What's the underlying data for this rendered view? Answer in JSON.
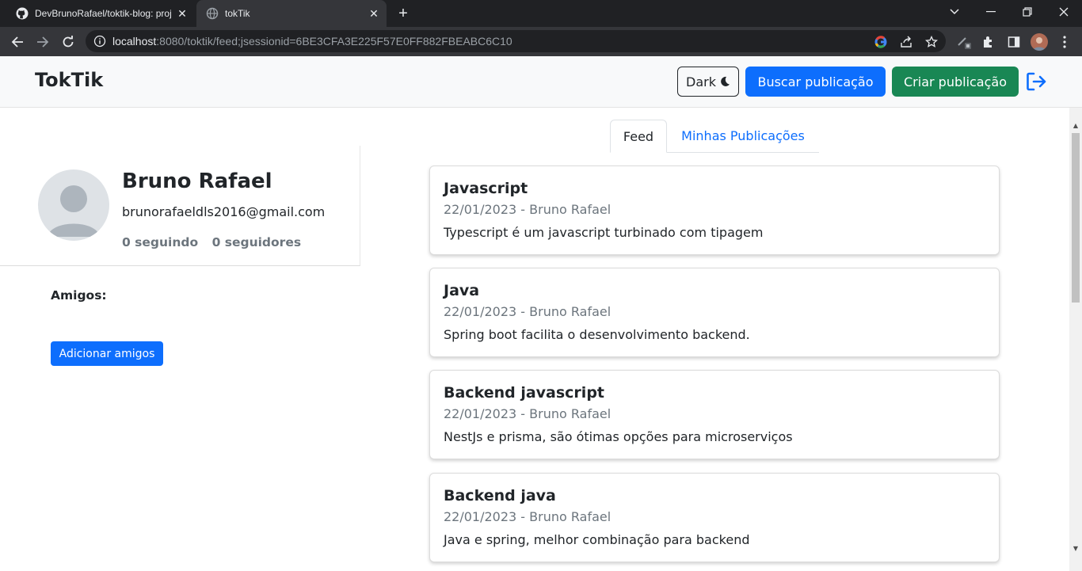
{
  "browser": {
    "tabs": [
      {
        "title": "DevBrunoRafael/toktik-blog: proj",
        "favicon": "github-icon",
        "active": false
      },
      {
        "title": "tokTik",
        "favicon": "globe-icon",
        "active": true
      }
    ],
    "url_host": "localhost",
    "url_rest": ":8080/toktik/feed;jsessionid=6BE3CFA3E225F57E0FF882FBEABC6C10"
  },
  "app": {
    "brand": "TokTik",
    "buttons": {
      "dark": "Dark",
      "search": "Buscar publicação",
      "create": "Criar publicação"
    }
  },
  "profile": {
    "name": "Bruno Rafael",
    "email": "brunorafaeldls2016@gmail.com",
    "following": "0 seguindo",
    "followers": "0 seguidores",
    "friends_label": "Amigos:",
    "add_friends": "Adicionar amigos"
  },
  "tabs": {
    "feed": "Feed",
    "mine": "Minhas Publicações"
  },
  "posts": [
    {
      "title": "Javascript",
      "meta": "22/01/2023 - Bruno Rafael",
      "body": "Typescript é um javascript turbinado com tipagem"
    },
    {
      "title": "Java",
      "meta": "22/01/2023 - Bruno Rafael",
      "body": "Spring boot facilita o desenvolvimento backend."
    },
    {
      "title": "Backend javascript",
      "meta": "22/01/2023 - Bruno Rafael",
      "body": "NestJs e prisma, são ótimas opções para microserviços"
    },
    {
      "title": "Backend java",
      "meta": "22/01/2023 - Bruno Rafael",
      "body": "Java e spring, melhor combinação para backend"
    }
  ],
  "colors": {
    "primary": "#0d6efd",
    "success": "#198754",
    "navbar_bg": "#f8f9fa",
    "text": "#212529",
    "muted": "#6c757d"
  }
}
